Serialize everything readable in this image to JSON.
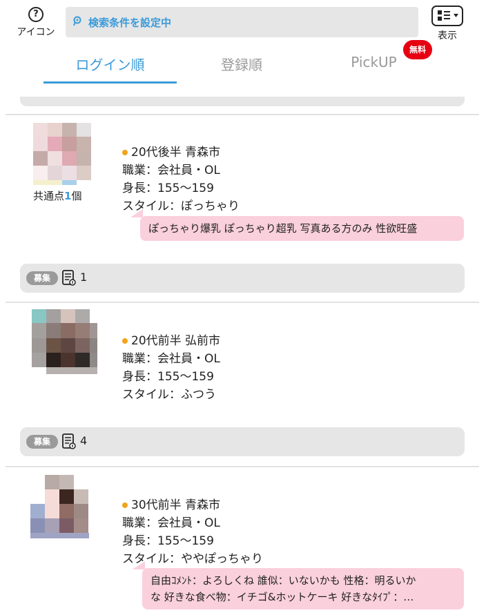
{
  "header": {
    "icon_label": "アイコン",
    "search_text": "検索条件を設定中",
    "view_label": "表示"
  },
  "tabs": [
    {
      "label": "ログイン順",
      "active": true
    },
    {
      "label": "登録順",
      "active": false
    },
    {
      "label": "PickUP",
      "active": false,
      "badge": "無料"
    }
  ],
  "users": [
    {
      "age_area": "20代後半 青森市",
      "job": "職業：会社員・OL",
      "height": "身長：155〜159",
      "style": "スタイル：ぽっちゃり",
      "common_prefix": "共通点",
      "common_count": "1",
      "common_suffix": "個",
      "comment_lines": [
        "ぽっちゃり爆乳 ぽっちゃり超乳 写真ある方のみ 性欲旺盛"
      ],
      "recruit_label": "募集",
      "recruit_count": "1"
    },
    {
      "age_area": "20代前半 弘前市",
      "job": "職業：会社員・OL",
      "height": "身長：155〜159",
      "style": "スタイル：ふつう",
      "recruit_label": "募集",
      "recruit_count": "4"
    },
    {
      "age_area": "30代前半 青森市",
      "job": "職業：会社員・OL",
      "height": "身長：155〜159",
      "style": "スタイル：ややぽっちゃり",
      "comment_lines": [
        "自由ｺﾒﾝﾄ：よろしくね 誰似：いないかも 性格：明るいか",
        "な 好きな食べ物：イチゴ&ホットケーキ 好きなﾀｲﾌﾟ：…"
      ]
    }
  ],
  "colors": {
    "accent": "#3a9ad9",
    "badge_red": "#e60012",
    "comment_pink": "#fad0dc",
    "dot_orange": "#f0a41c"
  }
}
